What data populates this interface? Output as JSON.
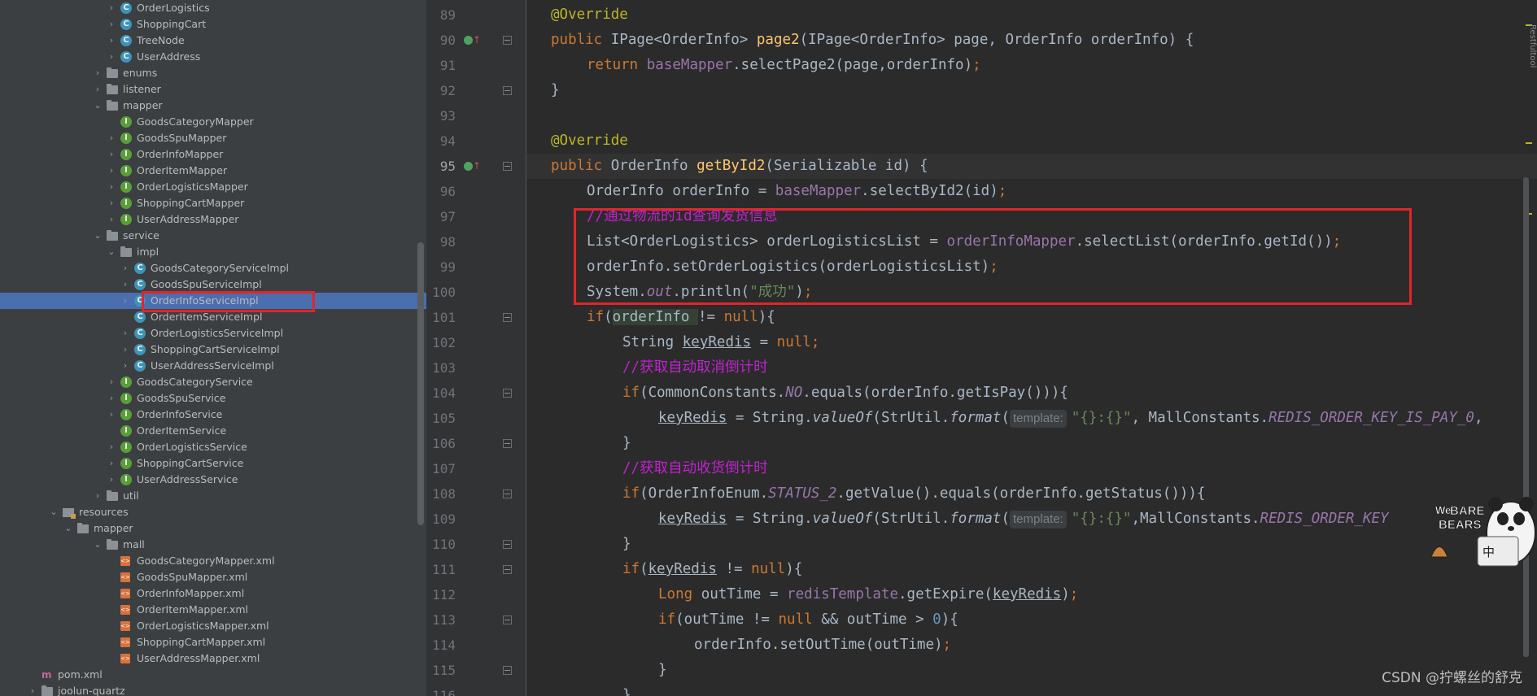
{
  "tree": {
    "rows": [
      {
        "label": "OrderLogistics",
        "icon": "class-icon",
        "depth": 4,
        "arrow": true
      },
      {
        "label": "ShoppingCart",
        "icon": "class-icon",
        "depth": 4,
        "arrow": true
      },
      {
        "label": "TreeNode",
        "icon": "class-icon",
        "depth": 4,
        "arrow": true
      },
      {
        "label": "UserAddress",
        "icon": "class-icon",
        "depth": 4,
        "arrow": true
      },
      {
        "label": "enums",
        "icon": "folder-icon",
        "depth": 3,
        "arrow": true
      },
      {
        "label": "listener",
        "icon": "folder-icon",
        "depth": 3,
        "arrow": true
      },
      {
        "label": "mapper",
        "icon": "folder-icon",
        "depth": 3,
        "arrow": true,
        "open": true
      },
      {
        "label": "GoodsCategoryMapper",
        "icon": "interface-icon",
        "depth": 4,
        "arrow": false
      },
      {
        "label": "GoodsSpuMapper",
        "icon": "interface-icon",
        "depth": 4,
        "arrow": true
      },
      {
        "label": "OrderInfoMapper",
        "icon": "interface-icon",
        "depth": 4,
        "arrow": true
      },
      {
        "label": "OrderItemMapper",
        "icon": "interface-icon",
        "depth": 4,
        "arrow": true
      },
      {
        "label": "OrderLogisticsMapper",
        "icon": "interface-icon",
        "depth": 4,
        "arrow": true
      },
      {
        "label": "ShoppingCartMapper",
        "icon": "interface-icon",
        "depth": 4,
        "arrow": true
      },
      {
        "label": "UserAddressMapper",
        "icon": "interface-icon",
        "depth": 4,
        "arrow": true
      },
      {
        "label": "service",
        "icon": "folder-icon",
        "depth": 3,
        "arrow": true,
        "open": true
      },
      {
        "label": "impl",
        "icon": "folder-icon",
        "depth": 4,
        "arrow": true,
        "open": true
      },
      {
        "label": "GoodsCategoryServiceImpl",
        "icon": "class-icon",
        "depth": 5,
        "arrow": true
      },
      {
        "label": "GoodsSpuServiceImpl",
        "icon": "class-icon",
        "depth": 5,
        "arrow": true
      },
      {
        "label": "OrderInfoServiceImpl",
        "icon": "class-icon",
        "depth": 5,
        "arrow": true,
        "selected": true
      },
      {
        "label": "OrderItemServiceImpl",
        "icon": "class-icon",
        "depth": 5,
        "arrow": false
      },
      {
        "label": "OrderLogisticsServiceImpl",
        "icon": "class-icon",
        "depth": 5,
        "arrow": true
      },
      {
        "label": "ShoppingCartServiceImpl",
        "icon": "class-icon",
        "depth": 5,
        "arrow": true
      },
      {
        "label": "UserAddressServiceImpl",
        "icon": "class-icon",
        "depth": 5,
        "arrow": true
      },
      {
        "label": "GoodsCategoryService",
        "icon": "interface-icon",
        "depth": 4,
        "arrow": true
      },
      {
        "label": "GoodsSpuService",
        "icon": "interface-icon",
        "depth": 4,
        "arrow": true
      },
      {
        "label": "OrderInfoService",
        "icon": "interface-icon",
        "depth": 4,
        "arrow": true
      },
      {
        "label": "OrderItemService",
        "icon": "interface-icon",
        "depth": 4,
        "arrow": false
      },
      {
        "label": "OrderLogisticsService",
        "icon": "interface-icon",
        "depth": 4,
        "arrow": true
      },
      {
        "label": "ShoppingCartService",
        "icon": "interface-icon",
        "depth": 4,
        "arrow": true
      },
      {
        "label": "UserAddressService",
        "icon": "interface-icon",
        "depth": 4,
        "arrow": true
      },
      {
        "label": "util",
        "icon": "folder-icon",
        "depth": 3,
        "arrow": true
      },
      {
        "label": "resources",
        "icon": "resources-icon",
        "depth": 1,
        "arrow": true,
        "open": true
      },
      {
        "label": "mapper",
        "icon": "folder-icon",
        "depth": 2,
        "arrow": true,
        "open": true
      },
      {
        "label": "mall",
        "icon": "folder-icon",
        "depth": 3,
        "arrow": true,
        "open": true
      },
      {
        "label": "GoodsCategoryMapper.xml",
        "icon": "xml-icon",
        "depth": 4,
        "arrow": false
      },
      {
        "label": "GoodsSpuMapper.xml",
        "icon": "xml-icon",
        "depth": 4,
        "arrow": false
      },
      {
        "label": "OrderInfoMapper.xml",
        "icon": "xml-icon",
        "depth": 4,
        "arrow": false
      },
      {
        "label": "OrderItemMapper.xml",
        "icon": "xml-icon",
        "depth": 4,
        "arrow": false
      },
      {
        "label": "OrderLogisticsMapper.xml",
        "icon": "xml-icon",
        "depth": 4,
        "arrow": false
      },
      {
        "label": "ShoppingCartMapper.xml",
        "icon": "xml-icon",
        "depth": 4,
        "arrow": false
      },
      {
        "label": "UserAddressMapper.xml",
        "icon": "xml-icon",
        "depth": 4,
        "arrow": false
      },
      {
        "label": "pom.xml",
        "icon": "maven-icon",
        "depth": 0,
        "arrow": false
      },
      {
        "label": "joolun-quartz",
        "icon": "folder-icon",
        "depth": 0,
        "arrow": true
      }
    ]
  },
  "editor": {
    "gutter": [
      {
        "n": "89"
      },
      {
        "n": "90",
        "override": true,
        "fold": true
      },
      {
        "n": "91"
      },
      {
        "n": "92",
        "fold": true
      },
      {
        "n": "93"
      },
      {
        "n": "94"
      },
      {
        "n": "95",
        "override": true,
        "fold": true,
        "current": true
      },
      {
        "n": "96"
      },
      {
        "n": "97"
      },
      {
        "n": "98"
      },
      {
        "n": "99"
      },
      {
        "n": "100"
      },
      {
        "n": "101",
        "fold": true
      },
      {
        "n": "102"
      },
      {
        "n": "103"
      },
      {
        "n": "104",
        "fold": true
      },
      {
        "n": "105"
      },
      {
        "n": "106",
        "fold": true
      },
      {
        "n": "107"
      },
      {
        "n": "108",
        "fold": true
      },
      {
        "n": "109"
      },
      {
        "n": "110",
        "fold": true
      },
      {
        "n": "111",
        "fold": true
      },
      {
        "n": "112"
      },
      {
        "n": "113",
        "fold": true
      },
      {
        "n": "114"
      },
      {
        "n": "115",
        "fold": true
      },
      {
        "n": "116"
      }
    ],
    "lines": [
      {
        "indent": 0,
        "segs": [
          [
            "ann",
            "@Override"
          ]
        ]
      },
      {
        "indent": 0,
        "segs": [
          [
            "kw",
            "public "
          ],
          [
            "",
            "IPage<OrderInfo> "
          ],
          [
            "fn",
            "page2"
          ],
          [
            "",
            "(IPage<OrderInfo> page, OrderInfo orderInfo) {"
          ]
        ]
      },
      {
        "indent": 1,
        "segs": [
          [
            "kw",
            "return "
          ],
          [
            "field",
            "baseMapper"
          ],
          [
            "",
            ".selectPage2(page,orderInfo)"
          ],
          [
            "kw",
            ";"
          ]
        ]
      },
      {
        "indent": 0,
        "segs": [
          [
            "",
            "}"
          ]
        ]
      },
      {
        "indent": 0,
        "segs": []
      },
      {
        "indent": 0,
        "segs": [
          [
            "ann",
            "@Override"
          ]
        ]
      },
      {
        "indent": 0,
        "segs": [
          [
            "kw",
            "public "
          ],
          [
            "",
            "OrderInfo "
          ],
          [
            "fn",
            "getById2"
          ],
          [
            "",
            "(Serializable id) {"
          ]
        ]
      },
      {
        "indent": 1,
        "segs": [
          [
            "",
            "OrderInfo orderInfo = "
          ],
          [
            "field",
            "baseMapper"
          ],
          [
            "",
            ".selectById2(id)"
          ],
          [
            "kw",
            ";"
          ]
        ]
      },
      {
        "indent": 1,
        "segs": [
          [
            "ucmt",
            "//通过物流的id查询发货信息"
          ]
        ]
      },
      {
        "indent": 1,
        "segs": [
          [
            "",
            "List<OrderLogistics> orderLogisticsList = "
          ],
          [
            "field",
            "orderInfoMapper"
          ],
          [
            "",
            ".selectList(orderInfo.getId())"
          ],
          [
            "kw",
            ";"
          ]
        ]
      },
      {
        "indent": 1,
        "segs": [
          [
            "",
            "orderInfo.setOrderLogistics(orderLogisticsList)"
          ],
          [
            "kw",
            ";"
          ]
        ]
      },
      {
        "indent": 1,
        "segs": [
          [
            "",
            "System."
          ],
          [
            "ifield",
            "out"
          ],
          [
            "",
            ".println("
          ],
          [
            "str",
            "\"成功\""
          ],
          [
            "",
            ")"
          ],
          [
            "kw",
            ";"
          ]
        ]
      },
      {
        "indent": 1,
        "segs": [
          [
            "kw",
            "if"
          ],
          [
            "",
            "("
          ],
          [
            "hl-var",
            "orderInfo "
          ],
          [
            "",
            "!= "
          ],
          [
            "kw",
            "null"
          ],
          [
            "",
            "){"
          ]
        ]
      },
      {
        "indent": 2,
        "segs": [
          [
            "",
            "String "
          ],
          [
            "ul",
            "keyRedis"
          ],
          [
            "",
            " = "
          ],
          [
            "kw",
            "null;"
          ]
        ]
      },
      {
        "indent": 2,
        "segs": [
          [
            "ucmt",
            "//获取自动取消倒计时"
          ]
        ]
      },
      {
        "indent": 2,
        "segs": [
          [
            "kw",
            "if"
          ],
          [
            "",
            "(CommonConstants."
          ],
          [
            "ifield",
            "NO"
          ],
          [
            "",
            ".equals(orderInfo.getIsPay())){"
          ]
        ]
      },
      {
        "indent": 3,
        "segs": [
          [
            "ul",
            "keyRedis"
          ],
          [
            "",
            " = String."
          ],
          [
            "imethod",
            "valueOf"
          ],
          [
            "",
            "(StrUtil."
          ],
          [
            "imethod",
            "format"
          ],
          [
            "",
            "("
          ],
          [
            "hint",
            "template:"
          ],
          [
            "str",
            "\"{}:{}\""
          ],
          [
            "",
            ", MallConstants."
          ],
          [
            "ifield",
            "REDIS_ORDER_KEY_IS_PAY_0"
          ],
          [
            "",
            ","
          ]
        ]
      },
      {
        "indent": 2,
        "segs": [
          [
            "",
            "}"
          ]
        ]
      },
      {
        "indent": 2,
        "segs": [
          [
            "ucmt",
            "//获取自动收货倒计时"
          ]
        ]
      },
      {
        "indent": 2,
        "segs": [
          [
            "kw",
            "if"
          ],
          [
            "",
            "(OrderInfoEnum."
          ],
          [
            "ifield",
            "STATUS_2"
          ],
          [
            "",
            ".getValue().equals(orderInfo.getStatus())){"
          ]
        ]
      },
      {
        "indent": 3,
        "segs": [
          [
            "ul",
            "keyRedis"
          ],
          [
            "",
            " = String."
          ],
          [
            "imethod",
            "valueOf"
          ],
          [
            "",
            "(StrUtil."
          ],
          [
            "imethod",
            "format"
          ],
          [
            "",
            "("
          ],
          [
            "hint",
            "template:"
          ],
          [
            "str",
            "\"{}:{}\""
          ],
          [
            "",
            ",MallConstants."
          ],
          [
            "ifield",
            "REDIS_ORDER_KEY"
          ]
        ]
      },
      {
        "indent": 2,
        "segs": [
          [
            "",
            "}"
          ]
        ]
      },
      {
        "indent": 2,
        "segs": [
          [
            "kw",
            "if"
          ],
          [
            "",
            "("
          ],
          [
            "ul",
            "keyRedis"
          ],
          [
            "",
            " != "
          ],
          [
            "kw",
            "null"
          ],
          [
            "",
            "){"
          ]
        ]
      },
      {
        "indent": 3,
        "segs": [
          [
            "kw",
            "Long "
          ],
          [
            "",
            "outTime = "
          ],
          [
            "field",
            "redisTemplate"
          ],
          [
            "",
            ".getExpire("
          ],
          [
            "ul",
            "keyRedis"
          ],
          [
            "",
            ")"
          ],
          [
            "kw",
            ";"
          ]
        ]
      },
      {
        "indent": 3,
        "segs": [
          [
            "kw",
            "if"
          ],
          [
            "",
            "(outTime != "
          ],
          [
            "kw",
            "null "
          ],
          [
            "",
            "&& outTime > "
          ],
          [
            "num",
            "0"
          ],
          [
            "",
            "){"
          ]
        ]
      },
      {
        "indent": 4,
        "segs": [
          [
            "",
            "orderInfo.setOutTime(outTime)"
          ],
          [
            "kw",
            ";"
          ]
        ]
      },
      {
        "indent": 3,
        "segs": [
          [
            "",
            "}"
          ]
        ]
      },
      {
        "indent": 2,
        "segs": [
          [
            "",
            "}"
          ]
        ]
      }
    ]
  },
  "sidebar_tab": "Restfultool",
  "watermark": "CSDN @拧螺丝的舒克",
  "sticker": {
    "line1": "We",
    "line2": "BARE",
    "line3": "BEARS",
    "cn": "中"
  },
  "colors": {
    "selection": "#4b6eaf",
    "highlight_box": "#e0262a",
    "keyword": "#cc7832",
    "annotation": "#bbb529",
    "field": "#9876aa",
    "comment": "#c022cf",
    "string": "#6a8759"
  }
}
